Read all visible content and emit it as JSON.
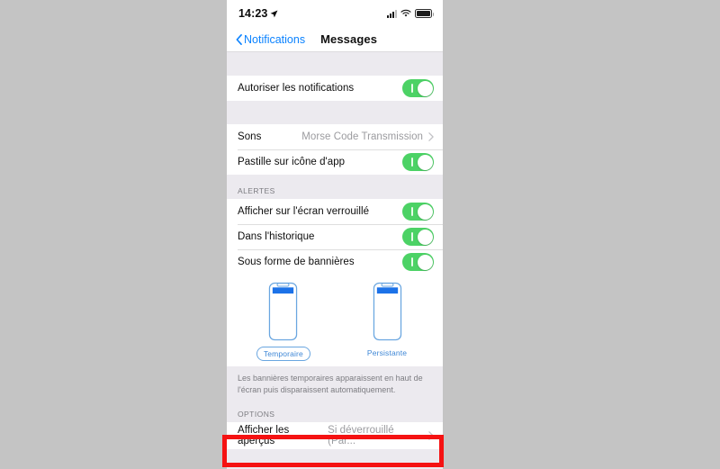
{
  "statusbar": {
    "time": "14:23",
    "location_icon": "location-arrow-icon",
    "signal_icon": "cellular-signal-icon",
    "wifi_icon": "wifi-icon",
    "battery_icon": "battery-full-icon"
  },
  "navbar": {
    "back_label": "Notifications",
    "back_icon": "chevron-left-icon",
    "title": "Messages"
  },
  "sections": {
    "allow": {
      "rows": [
        {
          "label": "Autoriser les notifications",
          "control": "toggle",
          "state": "on"
        }
      ]
    },
    "sound": {
      "rows": [
        {
          "label": "Sons",
          "value": "Morse Code Transmission",
          "control": "disclosure"
        },
        {
          "label": "Pastille sur icône d'app",
          "control": "toggle",
          "state": "on"
        }
      ]
    },
    "alerts": {
      "header": "ALERTES",
      "rows": [
        {
          "label": "Afficher sur l'écran verrouillé",
          "control": "toggle",
          "state": "on"
        },
        {
          "label": "Dans l'historique",
          "control": "toggle",
          "state": "on"
        },
        {
          "label": "Sous forme de bannières",
          "control": "toggle",
          "state": "on"
        }
      ],
      "picker": {
        "options": [
          {
            "caption": "Temporaire",
            "selected": true
          },
          {
            "caption": "Persistante",
            "selected": false
          }
        ]
      },
      "footnote": "Les bannières temporaires apparaissent en haut de l'écran puis disparaissent automatiquement."
    },
    "options": {
      "header": "OPTIONS",
      "rows": [
        {
          "label": "Afficher les aperçus",
          "value": "Si déverrouillé (Par...",
          "control": "disclosure"
        }
      ]
    }
  },
  "annotation": {
    "highlight_color": "#f51212",
    "target": "Afficher les aperçus"
  },
  "colors": {
    "toggle_on": "#4cd265",
    "tint_blue": "#0a82ff",
    "illustration_blue": "#3e87d6",
    "page_background": "#c4c4c4",
    "group_background": "#eceaef"
  },
  "bottom_strip": {
    "text": ""
  }
}
